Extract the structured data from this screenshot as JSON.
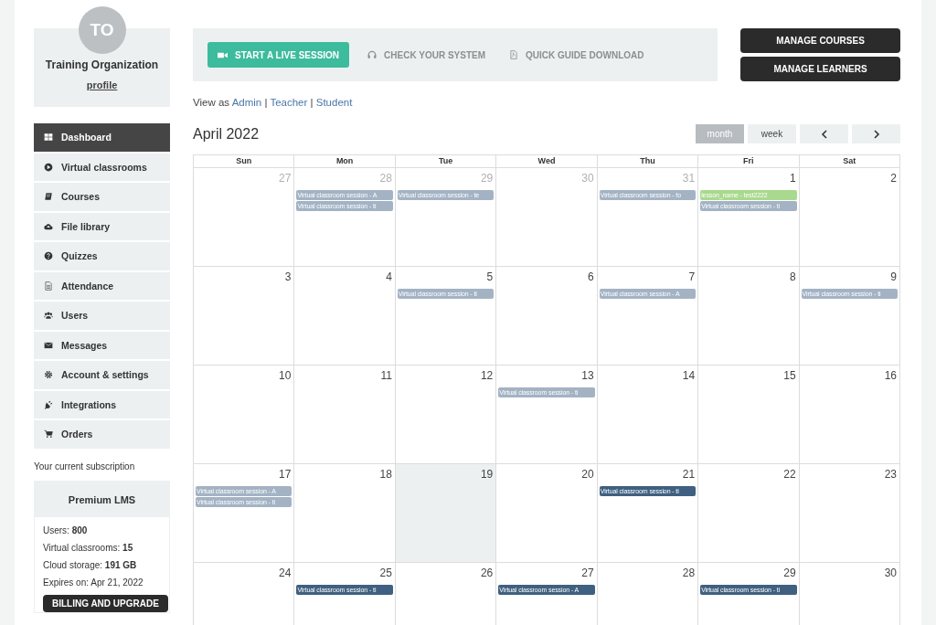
{
  "profile": {
    "initials": "TO",
    "name": "Training Organization",
    "link": "profile"
  },
  "sidebar": {
    "items": [
      {
        "label": "Dashboard",
        "selected": true
      },
      {
        "label": "Virtual classrooms",
        "selected": false
      },
      {
        "label": "Courses",
        "selected": false
      },
      {
        "label": "File library",
        "selected": false
      },
      {
        "label": "Quizzes",
        "selected": false
      },
      {
        "label": "Attendance",
        "selected": false
      },
      {
        "label": "Users",
        "selected": false
      },
      {
        "label": "Messages",
        "selected": false
      },
      {
        "label": "Account & settings",
        "selected": false
      },
      {
        "label": "Integrations",
        "selected": false
      },
      {
        "label": "Orders",
        "selected": false
      }
    ]
  },
  "subscription": {
    "label": "Your current subscription",
    "plan": "Premium LMS",
    "lines": [
      "Users: **800**",
      "Virtual classrooms: **15**",
      "Cloud storage: **191 GB**",
      "Expires on: Apr 21, 2022"
    ],
    "button": "BILLING AND UPGRADE"
  },
  "actions": [
    {
      "label": "START A LIVE SESSION",
      "kind": "primary"
    },
    {
      "label": "CHECK YOUR SYSTEM",
      "kind": "link"
    },
    {
      "label": "QUICK GUIDE DOWNLOAD",
      "kind": "link"
    }
  ],
  "manage_buttons": [
    "MANAGE COURSES",
    "MANAGE LEARNERS"
  ],
  "view_as": {
    "label": "View as",
    "separator": "|",
    "links": [
      "Admin",
      "Teacher",
      "Student"
    ]
  },
  "calendar": {
    "title": "April 2022",
    "views": [
      {
        "label": "month",
        "selected": true
      },
      {
        "label": "week",
        "selected": false
      }
    ],
    "weekdays": [
      "Sun",
      "Mon",
      "Tue",
      "Wed",
      "Thu",
      "Fri",
      "Sat"
    ],
    "weeks": [
      [
        {
          "day": "27",
          "other_month": true,
          "today": false
        },
        {
          "day": "28",
          "other_month": true,
          "today": false,
          "events": [
            {
              "title": "Virtual classroom session - A",
              "color": "#a3b3c4"
            },
            {
              "title": "Virtual classroom session - ti",
              "color": "#a3b3c4"
            }
          ]
        },
        {
          "day": "29",
          "other_month": true,
          "today": false,
          "events": [
            {
              "title": "Virtual classroom session - te",
              "color": "#a3b3c4"
            }
          ]
        },
        {
          "day": "30",
          "other_month": true,
          "today": false
        },
        {
          "day": "31",
          "other_month": true,
          "today": false,
          "events": [
            {
              "title": "Virtual classroom session - fo",
              "color": "#a3b3c4"
            }
          ]
        },
        {
          "day": "1",
          "other_month": false,
          "today": false,
          "events": [
            {
              "title": "lesson_name - test2222",
              "color": "#a9d98e"
            },
            {
              "title": "Virtual classroom session - ti",
              "color": "#a3b3c4"
            }
          ]
        },
        {
          "day": "2",
          "other_month": false,
          "today": false
        }
      ],
      [
        {
          "day": "3",
          "other_month": false,
          "today": false
        },
        {
          "day": "4",
          "other_month": false,
          "today": false
        },
        {
          "day": "5",
          "other_month": false,
          "today": false,
          "events": [
            {
              "title": "Virtual classroom session - ti",
              "color": "#a3b3c4"
            }
          ]
        },
        {
          "day": "6",
          "other_month": false,
          "today": false
        },
        {
          "day": "7",
          "other_month": false,
          "today": false,
          "events": [
            {
              "title": "Virtual classroom session - A",
              "color": "#a3b3c4"
            }
          ]
        },
        {
          "day": "8",
          "other_month": false,
          "today": false
        },
        {
          "day": "9",
          "other_month": false,
          "today": false,
          "events": [
            {
              "title": "Virtual classroom session - ti",
              "color": "#a3b3c4"
            }
          ]
        }
      ],
      [
        {
          "day": "10",
          "other_month": false,
          "today": false
        },
        {
          "day": "11",
          "other_month": false,
          "today": false
        },
        {
          "day": "12",
          "other_month": false,
          "today": false
        },
        {
          "day": "13",
          "other_month": false,
          "today": false,
          "events": [
            {
              "title": "Virtual classroom session - ti",
              "color": "#a3b3c4"
            }
          ]
        },
        {
          "day": "14",
          "other_month": false,
          "today": false
        },
        {
          "day": "15",
          "other_month": false,
          "today": false
        },
        {
          "day": "16",
          "other_month": false,
          "today": false
        }
      ],
      [
        {
          "day": "17",
          "other_month": false,
          "today": false,
          "events": [
            {
              "title": "Virtual classroom session - A",
              "color": "#a3b3c4"
            },
            {
              "title": "Virtual classroom session - ti",
              "color": "#a3b3c4"
            }
          ]
        },
        {
          "day": "18",
          "other_month": false,
          "today": false
        },
        {
          "day": "19",
          "other_month": false,
          "today": true
        },
        {
          "day": "20",
          "other_month": false,
          "today": false
        },
        {
          "day": "21",
          "other_month": false,
          "today": false,
          "events": [
            {
              "title": "Virtual classroom session - ti",
              "color": "#3f6080"
            }
          ]
        },
        {
          "day": "22",
          "other_month": false,
          "today": false
        },
        {
          "day": "23",
          "other_month": false,
          "today": false
        }
      ],
      [
        {
          "day": "24",
          "other_month": false,
          "today": false
        },
        {
          "day": "25",
          "other_month": false,
          "today": false,
          "events": [
            {
              "title": "Virtual classroom session - ti",
              "color": "#3f6080"
            }
          ]
        },
        {
          "day": "26",
          "other_month": false,
          "today": false
        },
        {
          "day": "27",
          "other_month": false,
          "today": false,
          "events": [
            {
              "title": "Virtual classroom session - A",
              "color": "#3f6080"
            }
          ]
        },
        {
          "day": "28",
          "other_month": false,
          "today": false
        },
        {
          "day": "29",
          "other_month": false,
          "today": false,
          "events": [
            {
              "title": "Virtual classroom session - ti",
              "color": "#3f6080"
            }
          ]
        },
        {
          "day": "30",
          "other_month": false,
          "today": false
        }
      ]
    ]
  }
}
